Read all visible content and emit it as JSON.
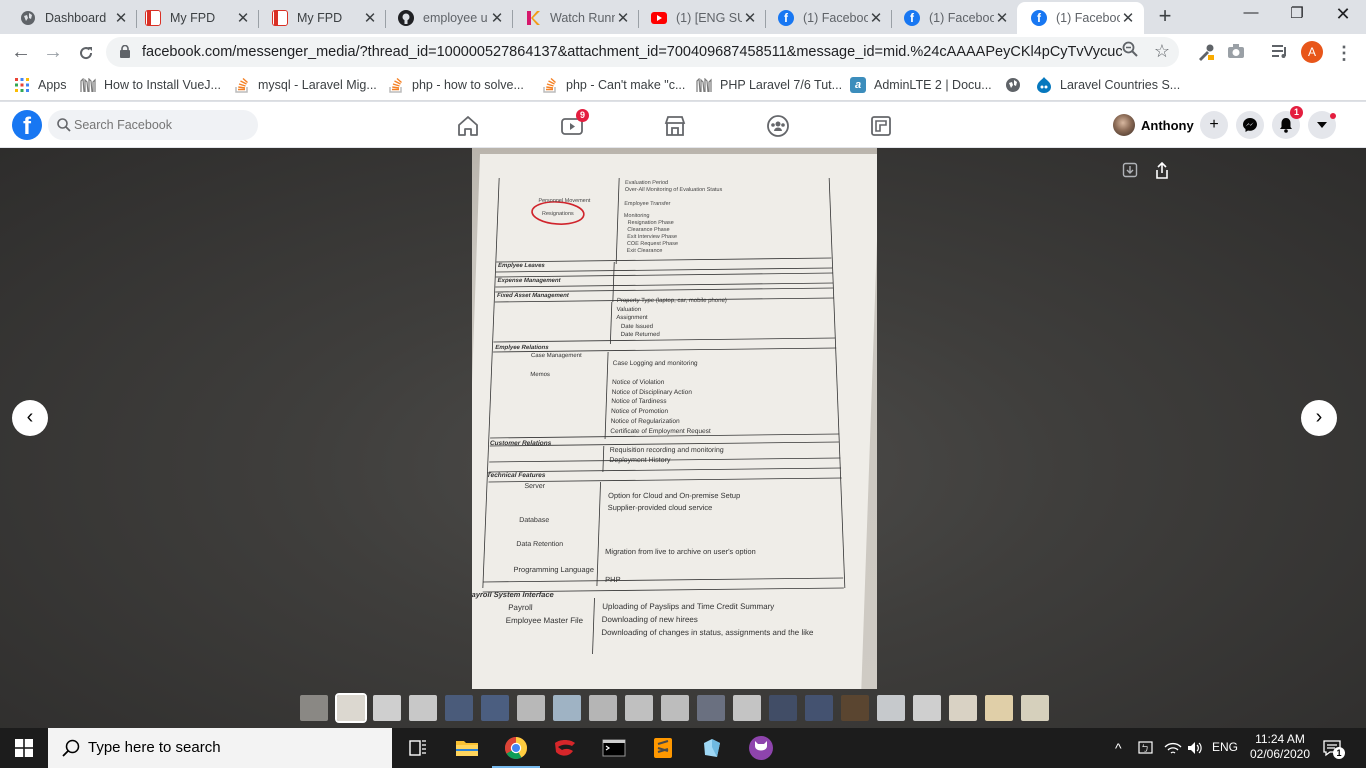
{
  "tabs": [
    {
      "title": "Dashboard",
      "icon": "globe-icon",
      "active": false
    },
    {
      "title": "My FPD",
      "icon": "pdf-icon",
      "active": false
    },
    {
      "title": "My FPD",
      "icon": "pdf-icon",
      "active": false
    },
    {
      "title": "employee u",
      "icon": "github-icon",
      "active": false
    },
    {
      "title": "Watch Runn",
      "icon": "k-icon",
      "active": false
    },
    {
      "title": "(1) [ENG SU",
      "icon": "youtube-icon",
      "active": false
    },
    {
      "title": "(1) Faceboo",
      "icon": "facebook-icon",
      "active": false
    },
    {
      "title": "(1) Faceboo",
      "icon": "facebook-icon",
      "active": false
    },
    {
      "title": "(1) Faceboo",
      "icon": "facebook-icon",
      "active": true
    }
  ],
  "toolbar": {
    "url": "facebook.com/messenger_media/?thread_id=100000527864137&attachment_id=700409687458511&message_id=mid.%24cAAAAPeyCKl4pCyTvVycucve...",
    "profile_initial": "A"
  },
  "bookmarks": [
    {
      "label": "Apps",
      "icon": "apps-grid-icon"
    },
    {
      "label": "How to Install VueJ...",
      "icon": "bookmark-site-icon"
    },
    {
      "label": "mysql - Laravel Mig...",
      "icon": "stackoverflow-icon"
    },
    {
      "label": "php - how to solve...",
      "icon": "stackoverflow-icon"
    },
    {
      "label": "php - Can't make \"c...",
      "icon": "stackoverflow-icon"
    },
    {
      "label": "PHP Laravel 7/6 Tut...",
      "icon": "bookmark-site-icon"
    },
    {
      "label": "AdminLTE 2 | Docu...",
      "icon": "adminlte-icon"
    },
    {
      "label": "",
      "icon": "globe-icon"
    },
    {
      "label": "Laravel Countries S...",
      "icon": "drupal-icon"
    }
  ],
  "facebook": {
    "logo": "f",
    "search_placeholder": "Search Facebook",
    "watch_badge": "9",
    "notifications_badge": "1",
    "profile_name": "Anthony",
    "colors": {
      "brand": "#1877f2",
      "badge": "#e41e3f"
    }
  },
  "document": {
    "personnel_movement": "Personnel Movement",
    "resignations": "Resignations",
    "pm_items": [
      "Evaluation Period",
      "Over-All Monitoring of Evaluation Status",
      "Employee Transfer",
      "Monitoring",
      "Resignation Phase",
      "Clearance Phase",
      "Exit Interview Phase",
      "COE Request Phase",
      "Exit Clearance"
    ],
    "employee_leaves": "Emplyee Leaves",
    "expense_management": "Expense Management",
    "fixed_asset_management": "Fixed Asset Management",
    "fam_items": [
      "Property Type (laptop, car, mobile phone)",
      "Valuation",
      "Assignment",
      "Date Issued",
      "Date Returned"
    ],
    "employee_relations": "Emplyee Relations",
    "case_management": "Case Management",
    "case_logging": "Case Logging and monitoring",
    "memos": "Memos",
    "memo_items": [
      "Notice of Violation",
      "Notice of Disciplinary Action",
      "Notice of Tardiness",
      "Notice of Promotion",
      "Notice of Regularization",
      "Certificate of Employment Request"
    ],
    "customer_relations": "Customer Relations",
    "cr_items": [
      "Requisition recording and monitoring",
      "Deployment History"
    ],
    "technical_features": "Technical Features",
    "server": "Server",
    "server_items": [
      "Option for Cloud and On-premise Setup",
      "Supplier-provided cloud service"
    ],
    "database": "Database",
    "data_retention": "Data Retention",
    "migration": "Migration from live to archive on user's option",
    "programming_language": "Programming Language",
    "php": "PHP",
    "payroll_interface": "Payroll System Interface",
    "payroll": "Payroll",
    "employee_master_file": "Employee Master File",
    "payroll_items": [
      "Uploading of Payslips and Time Credit Summary",
      "Downloading of new hirees",
      "Downloading of changes in status, assignments and the like"
    ]
  },
  "taskbar": {
    "search_placeholder": "Type here to search",
    "language": "ENG",
    "time": "11:24 AM",
    "date": "02/06/2020",
    "notification_count": "1"
  }
}
